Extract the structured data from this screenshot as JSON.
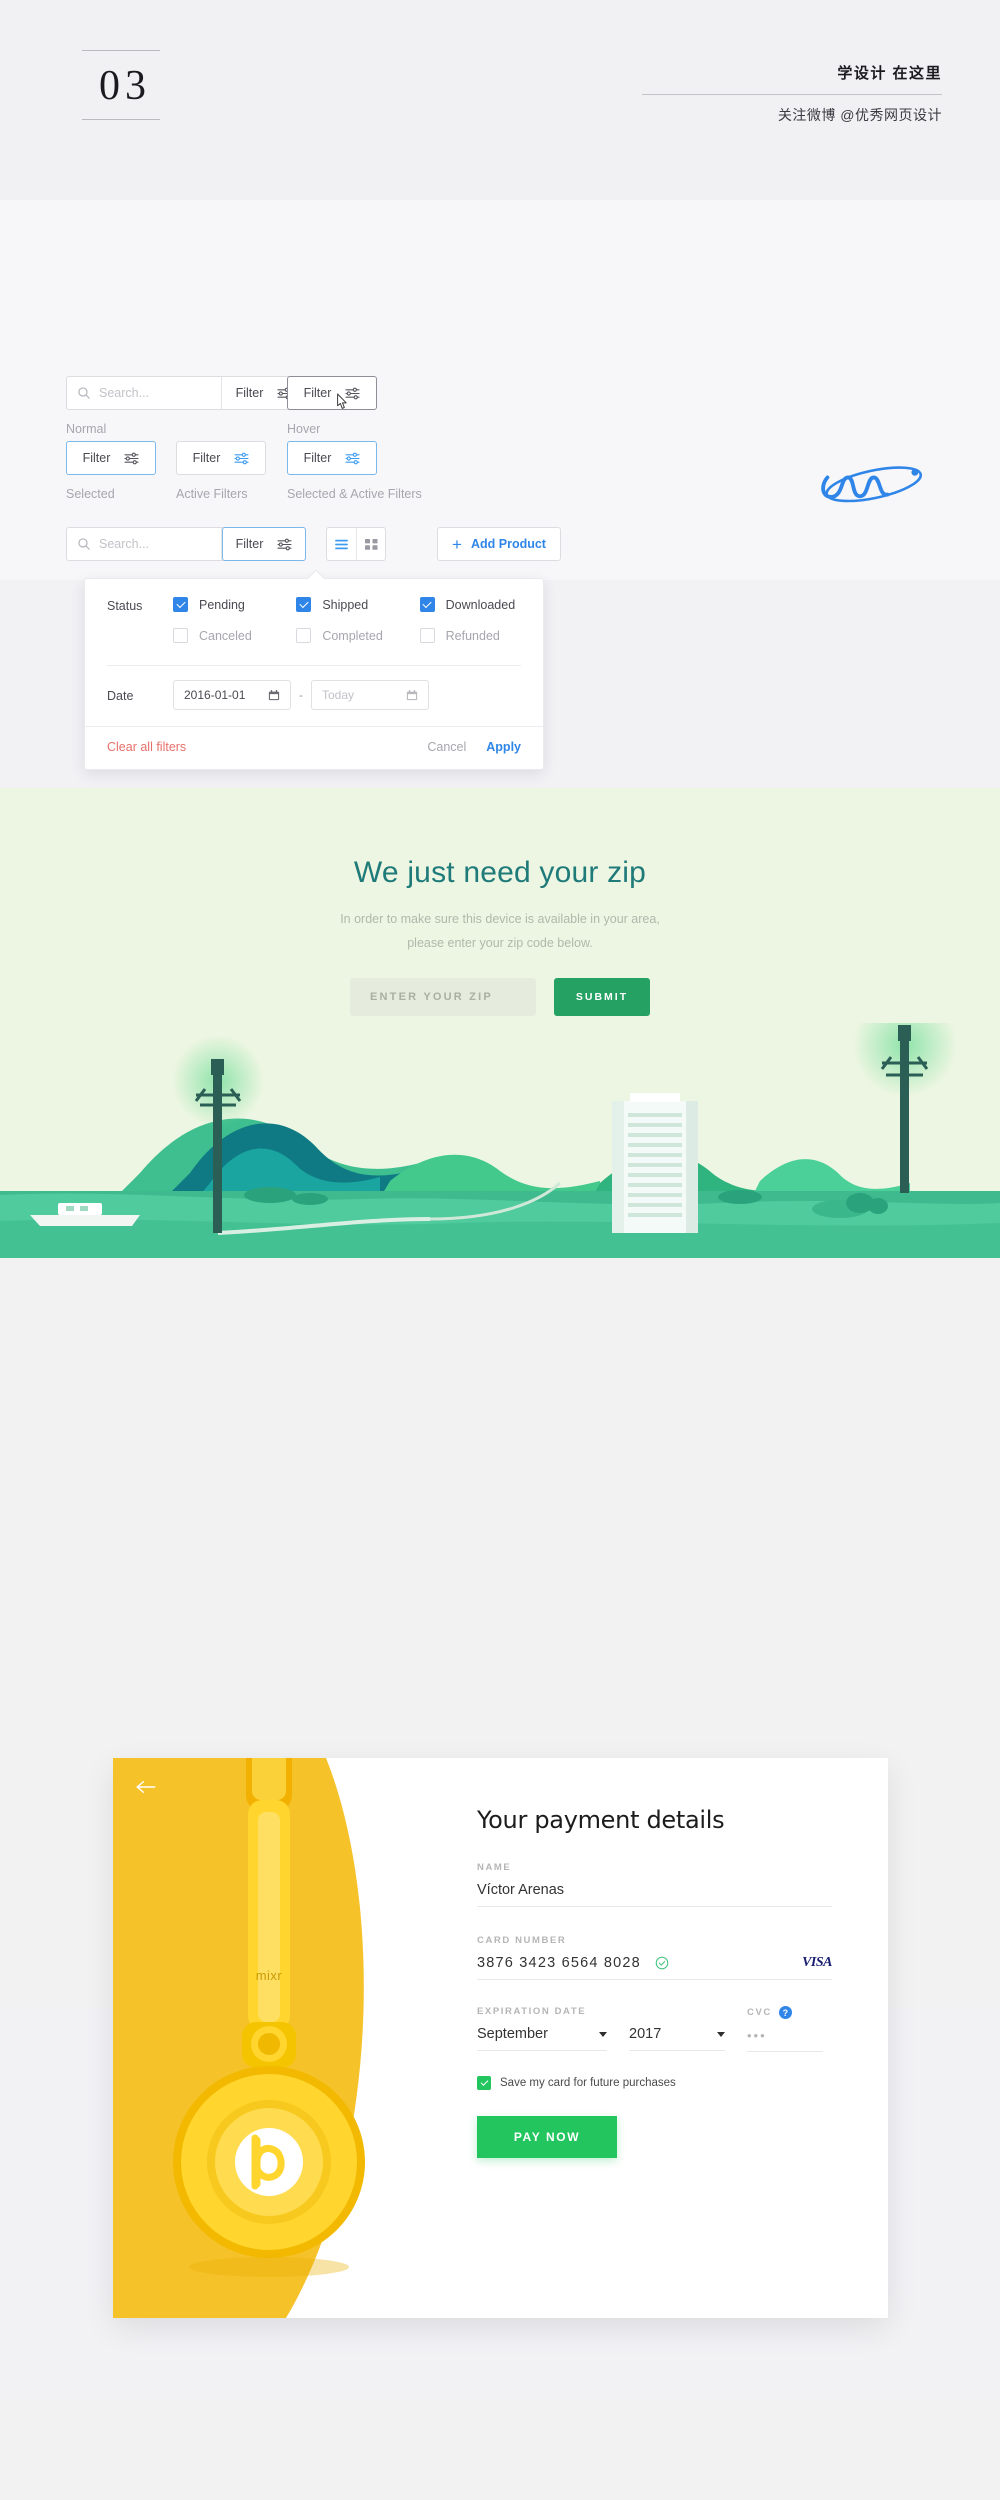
{
  "header": {
    "number": "03",
    "tagline": "学设计 在这里",
    "weibo": "关注微博 @优秀网页设计"
  },
  "filters": {
    "search_placeholder": "Search...",
    "filter_label": "Filter",
    "states": {
      "normal": "Normal",
      "hover": "Hover",
      "selected": "Selected",
      "active": "Active Filters",
      "selected_active": "Selected & Active Filters"
    },
    "toolbar": {
      "add_product": "Add Product",
      "plus": "+"
    },
    "panel": {
      "status_label": "Status",
      "checkboxes": [
        {
          "label": "Pending",
          "checked": true
        },
        {
          "label": "Shipped",
          "checked": true
        },
        {
          "label": "Downloaded",
          "checked": true
        },
        {
          "label": "Canceled",
          "checked": false
        },
        {
          "label": "Completed",
          "checked": false
        },
        {
          "label": "Refunded",
          "checked": false
        }
      ],
      "date_label": "Date",
      "date_from": "2016-01-01",
      "date_to_placeholder": "Today",
      "date_separator": "-",
      "clear_all": "Clear all filters",
      "cancel": "Cancel",
      "apply": "Apply"
    },
    "colors": {
      "accent_blue": "#2f86e8",
      "danger_red": "#e8706b",
      "border": "#dcdce1"
    }
  },
  "zip": {
    "title": "We just need your zip",
    "subtitle_line1": "In order to make sure this device is available in your area,",
    "subtitle_line2": "please enter your zip code below.",
    "input_placeholder": "ENTER YOUR ZIP",
    "submit_label": "SUBMIT",
    "colors": {
      "bg": "#edf6e2",
      "title": "#1f7a7a",
      "button": "#25a263"
    }
  },
  "payment": {
    "title": "Your payment details",
    "brand_text": "mixr",
    "name_label": "NAME",
    "name_value": "Víctor Arenas",
    "card_label": "CARD NUMBER",
    "card_value": "3876  3423  6564  8028",
    "card_brand": "VISA",
    "exp_label": "EXPIRATION DATE",
    "exp_month": "September",
    "exp_year": "2017",
    "cvc_label": "CVC",
    "cvc_help": "?",
    "cvc_value": "•••",
    "save_label": "Save my card for future purchases",
    "save_checked": true,
    "pay_label": "PAY NOW",
    "colors": {
      "card_yellow": "#f6c22a",
      "pay_green": "#22c55e"
    }
  }
}
